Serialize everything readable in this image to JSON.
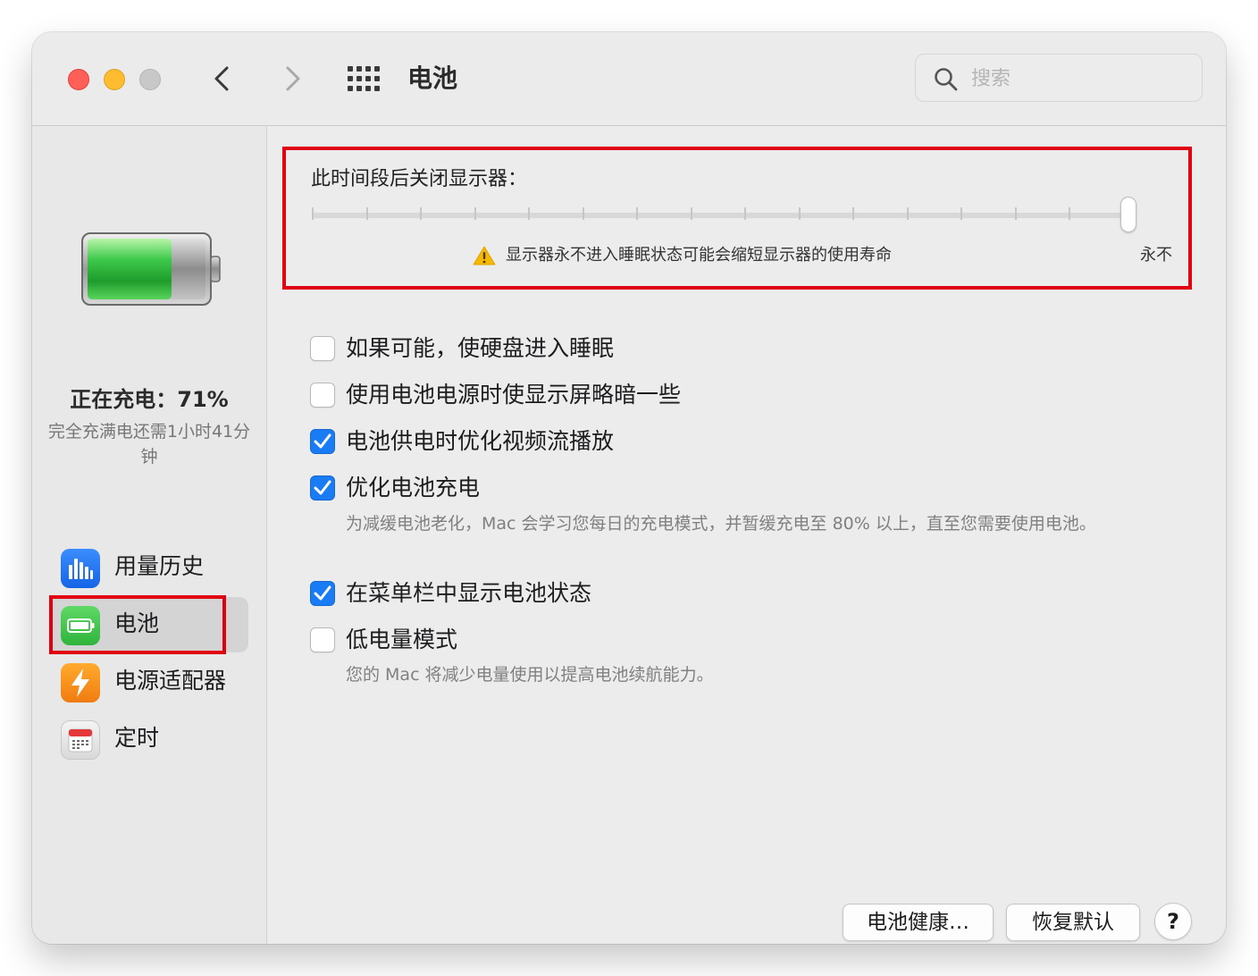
{
  "window": {
    "title": "电池",
    "search": {
      "placeholder": "搜索",
      "value": ""
    },
    "nav": {
      "back_icon": "chevron-left-icon",
      "forward_icon": "chevron-right-icon",
      "grid_icon": "show-all-grid-icon"
    }
  },
  "sidebar": {
    "battery_status": "正在充电：71%",
    "time_remaining": "完全充满电还需1小时41分钟",
    "battery_level_fraction": 0.71,
    "items": [
      {
        "label": "用量历史",
        "icon": "usage-history-icon",
        "selected": false
      },
      {
        "label": "电池",
        "icon": "battery-icon",
        "selected": true
      },
      {
        "label": "电源适配器",
        "icon": "power-adapter-icon",
        "selected": false
      },
      {
        "label": "定时",
        "icon": "schedule-calendar-icon",
        "selected": false
      }
    ]
  },
  "display_sleep": {
    "label": "此时间段后关闭显示器：",
    "warning": "显示器永不进入睡眠状态可能会缩短显示器的使用寿命",
    "end_label": "永不",
    "slider_value_fraction": 1.0
  },
  "options": [
    {
      "label": "如果可能，使硬盘进入睡眠",
      "checked": false
    },
    {
      "label": "使用电池电源时使显示屏略暗一些",
      "checked": false
    },
    {
      "label": "电池供电时优化视频流播放",
      "checked": true
    },
    {
      "label": "优化电池充电",
      "checked": true,
      "description": "为减缓电池老化，Mac 会学习您每日的充电模式，并暂缓充电至 80% 以上，直至您需要使用电池。"
    },
    {
      "label": "在菜单栏中显示电池状态",
      "checked": true
    },
    {
      "label": "低电量模式",
      "checked": false,
      "description": "您的 Mac 将减少电量使用以提高电池续航能力。"
    }
  ],
  "buttons": {
    "battery_health": "电池健康…",
    "restore_defaults": "恢复默认",
    "help": "?"
  },
  "colors": {
    "highlight_red": "#e0000f",
    "checkbox_blue": "#1a7cf5",
    "battery_green": "#3cc84a",
    "warning_yellow": "#f5b800"
  }
}
